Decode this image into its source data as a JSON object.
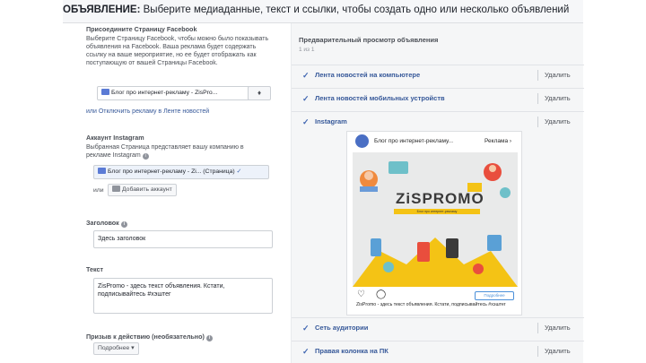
{
  "header": {
    "title_bold": "ОБЪЯВЛЕНИЕ:",
    "title_rest": " Выберите медиаданные, текст и ссылки, чтобы создать одно или несколько объявлений"
  },
  "facebook_page": {
    "title": "Присоедините Страницу Facebook",
    "description": "Выберите Страницу Facebook, чтобы можно было показывать объявления на Facebook. Ваша реклама будет содержать ссылку на ваше мероприятие, но ее будет отображать как поступающую от вашей Страницы Facebook.",
    "selected": "Блог про интернет-рекламу - ZisPro...",
    "stepper": "♦",
    "disable_link": "или Отключить рекламу в Ленте новостей"
  },
  "instagram_account": {
    "title": "Аккаунт Instagram",
    "description": "Выбранная Страница представляет вашу компанию в рекламе Instagram",
    "selected": "Блог про интернет-рекламу - Zi... (Страница)",
    "or": "или",
    "add_button": "Добавить аккаунт"
  },
  "headline": {
    "label": "Заголовок",
    "value": "Здесь заголовок"
  },
  "text": {
    "label": "Текст",
    "value": "ZisPromo - здесь текст объявления. Кстати, подписывайтесь #хэштег"
  },
  "cta": {
    "label": "Призыв к действию (необязательно)",
    "selected": "Подробнее"
  },
  "preview": {
    "title": "Предварительный просмотр объявления",
    "count": "1 из 1",
    "rows": [
      {
        "label": "Лента новостей на компьютере",
        "delete": "Удалить"
      },
      {
        "label": "Лента новостей мобильных устройств",
        "delete": "Удалить"
      },
      {
        "label": "Instagram",
        "delete": "Удалить"
      },
      {
        "label": "Сеть аудитории",
        "delete": "Удалить"
      },
      {
        "label": "Правая колонка на ПК",
        "delete": "Удалить"
      }
    ]
  },
  "instagram_card": {
    "account": "Блог про интернет-рекламу...",
    "sponsored": "Реклама",
    "logo": "ZiSPROMO",
    "logo_sub": "Блог про интернет-рекламу",
    "more_button": "Подробнее",
    "caption": "ZisPromo - здесь текст объявления. Кстати, подписывайтесь #хэштег"
  },
  "colors": {
    "link": "#365899",
    "accent": "#4267b2",
    "logo_band": "#f4c315"
  }
}
